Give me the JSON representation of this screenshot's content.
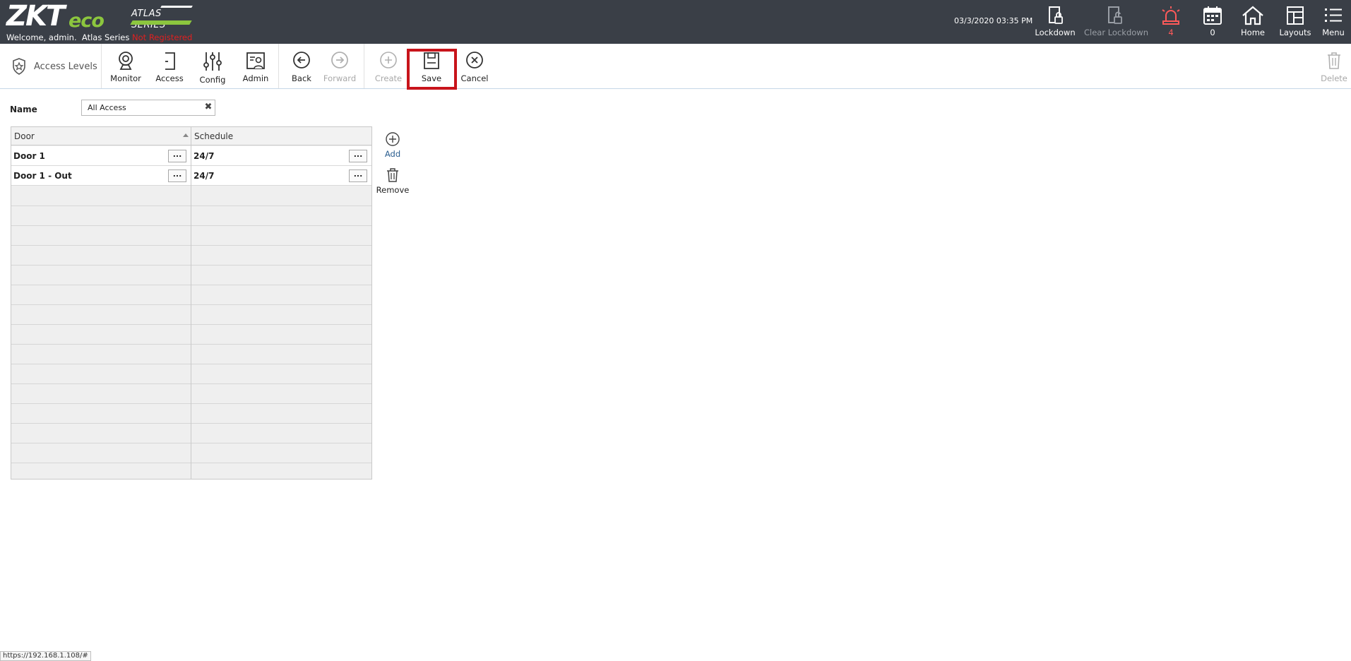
{
  "header": {
    "logo_zk": "ZKT",
    "logo_eco": "eco",
    "series_logo": "ATLAS SERIES",
    "welcome": "Welcome, admin.",
    "product": "Atlas Series",
    "registration": "Not Registered",
    "datetime": "03/3/2020 03:35 PM",
    "buttons": {
      "lockdown": "Lockdown",
      "clear_lockdown": "Clear Lockdown",
      "alarms_count": "4",
      "events_count": "0",
      "home": "Home",
      "layouts": "Layouts",
      "menu": "Menu"
    },
    "colors": {
      "background": "#3a3f47",
      "alarm": "#ff5a5a",
      "brand_green": "#8cc63e",
      "not_registered": "#e02020"
    }
  },
  "toolbar": {
    "breadcrumb": "Access Levels",
    "monitor": "Monitor",
    "access": "Access",
    "config": "Config",
    "admin": "Admin",
    "back": "Back",
    "forward": "Forward",
    "create": "Create",
    "save": "Save",
    "cancel": "Cancel",
    "delete": "Delete",
    "highlight_color": "#c8141b"
  },
  "form": {
    "name_label": "Name",
    "name_value": "All Access"
  },
  "grid": {
    "columns": [
      "Door",
      "Schedule"
    ],
    "sort": "Door ascending",
    "rows": [
      {
        "door": "Door 1",
        "schedule": "24/7"
      },
      {
        "door": "Door 1 - Out",
        "schedule": "24/7"
      }
    ],
    "ellipsis": "..."
  },
  "actions": {
    "add": "Add",
    "remove": "Remove"
  },
  "status_bar": {
    "url": "https://192.168.1.108/#"
  }
}
